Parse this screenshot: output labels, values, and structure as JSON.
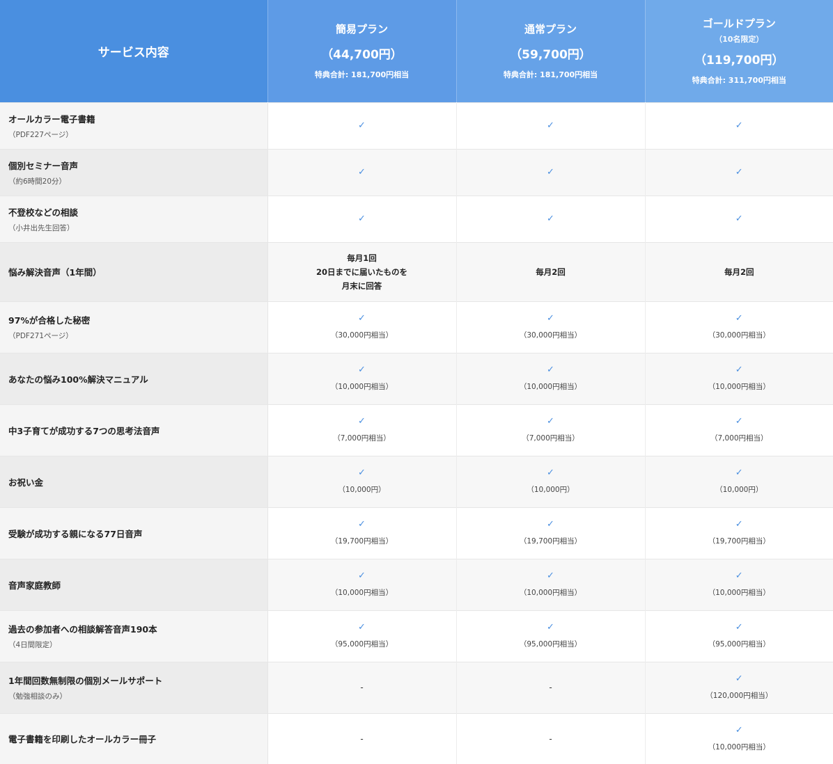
{
  "header": {
    "service_label": "サービス内容",
    "plans": [
      {
        "name": "簡易プラン",
        "price": "（44,700円）",
        "total": "特典合計: 181,700円相当"
      },
      {
        "name": "通常プラン",
        "price": "（59,700円）",
        "total": "特典合計: 181,700円相当"
      },
      {
        "name": "ゴールドプラン",
        "limit": "（10名限定）",
        "price": "（119,700円）",
        "total": "特典合計: 311,700円相当"
      }
    ]
  },
  "check_symbol": "✓",
  "colors": {
    "accent": "#4a8fe0",
    "header_plan_1": "#5e9be6",
    "header_plan_2": "#66a2e8",
    "header_plan_3": "#70aaea"
  },
  "rows": [
    {
      "name": "オールカラー電子書籍",
      "sub": "（PDF227ページ）",
      "cells": [
        {
          "type": "check"
        },
        {
          "type": "check"
        },
        {
          "type": "check"
        }
      ]
    },
    {
      "name": "個別セミナー音声",
      "sub": "（約6時間20分）",
      "cells": [
        {
          "type": "check"
        },
        {
          "type": "check"
        },
        {
          "type": "check"
        }
      ]
    },
    {
      "name": "不登校などの相談",
      "sub": "（小井出先生回答）",
      "cells": [
        {
          "type": "check"
        },
        {
          "type": "check"
        },
        {
          "type": "check"
        }
      ]
    },
    {
      "name": "悩み解決音声（1年間）",
      "cells": [
        {
          "type": "text",
          "lines": [
            "毎月1回",
            "20日までに届いたものを",
            "月末に回答"
          ]
        },
        {
          "type": "text",
          "lines": [
            "毎月2回"
          ]
        },
        {
          "type": "text",
          "lines": [
            "毎月2回"
          ]
        }
      ]
    },
    {
      "name": "97%が合格した秘密",
      "sub": "（PDF271ページ）",
      "cells": [
        {
          "type": "check",
          "note": "（30,000円相当）"
        },
        {
          "type": "check",
          "note": "（30,000円相当）"
        },
        {
          "type": "check",
          "note": "（30,000円相当）"
        }
      ]
    },
    {
      "name": "あなたの悩み100%解決マニュアル",
      "cells": [
        {
          "type": "check",
          "note": "（10,000円相当）"
        },
        {
          "type": "check",
          "note": "（10,000円相当）"
        },
        {
          "type": "check",
          "note": "（10,000円相当）"
        }
      ]
    },
    {
      "name": "中3子育てが成功する7つの思考法音声",
      "cells": [
        {
          "type": "check",
          "note": "（7,000円相当）"
        },
        {
          "type": "check",
          "note": "（7,000円相当）"
        },
        {
          "type": "check",
          "note": "（7,000円相当）"
        }
      ]
    },
    {
      "name": "お祝い金",
      "cells": [
        {
          "type": "check",
          "note": "（10,000円）"
        },
        {
          "type": "check",
          "note": "（10,000円）"
        },
        {
          "type": "check",
          "note": "（10,000円）"
        }
      ]
    },
    {
      "name": "受験が成功する親になる77日音声",
      "cells": [
        {
          "type": "check",
          "note": "（19,700円相当）"
        },
        {
          "type": "check",
          "note": "（19,700円相当）"
        },
        {
          "type": "check",
          "note": "（19,700円相当）"
        }
      ]
    },
    {
      "name": "音声家庭教師",
      "cells": [
        {
          "type": "check",
          "note": "（10,000円相当）"
        },
        {
          "type": "check",
          "note": "（10,000円相当）"
        },
        {
          "type": "check",
          "note": "（10,000円相当）"
        }
      ]
    },
    {
      "name": "過去の参加者への相談解答音声190本",
      "sub": "（4日間限定）",
      "cells": [
        {
          "type": "check",
          "note": "（95,000円相当）"
        },
        {
          "type": "check",
          "note": "（95,000円相当）"
        },
        {
          "type": "check",
          "note": "（95,000円相当）"
        }
      ]
    },
    {
      "name": "1年間回数無制限の個別メールサポート",
      "sub": "（勉強相談のみ）",
      "cells": [
        {
          "type": "dash",
          "text": "-"
        },
        {
          "type": "dash",
          "text": "-"
        },
        {
          "type": "check",
          "note": "（120,000円相当）"
        }
      ]
    },
    {
      "name": "電子書籍を印刷したオールカラー冊子",
      "cells": [
        {
          "type": "dash",
          "text": "-"
        },
        {
          "type": "dash",
          "text": "-"
        },
        {
          "type": "check",
          "note": "（10,000円相当）"
        }
      ]
    }
  ]
}
